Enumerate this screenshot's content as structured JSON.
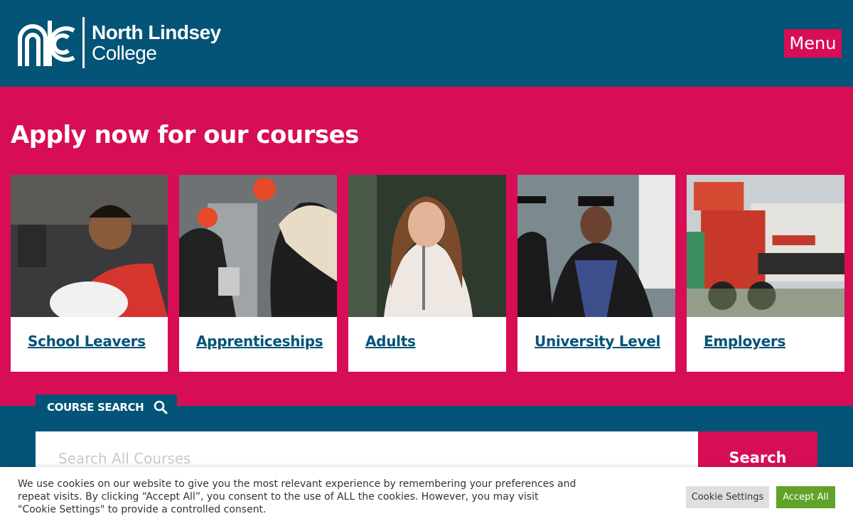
{
  "header": {
    "logo_line1": "North Lindsey",
    "logo_line2": "College",
    "menu_label": "Menu"
  },
  "apply": {
    "title": "Apply now for our courses",
    "cards": [
      {
        "label": "School Leavers"
      },
      {
        "label": "Apprenticeships"
      },
      {
        "label": "Adults"
      },
      {
        "label": "University Level"
      },
      {
        "label": "Employers"
      }
    ]
  },
  "search": {
    "tab_label": "COURSE SEARCH",
    "placeholder": "Search All Courses",
    "button_label": "Search"
  },
  "cookie": {
    "text": "We use cookies on our website to give you the most relevant experience by remembering your preferences and repeat visits. By clicking “Accept All”, you consent to the use of ALL the cookies. However, you may visit \"Cookie Settings\" to provide a controlled consent.",
    "settings_label": "Cookie Settings",
    "accept_label": "Accept All"
  },
  "colors": {
    "navy": "#045477",
    "pink": "#d70d55",
    "accept_green": "#61a229"
  }
}
